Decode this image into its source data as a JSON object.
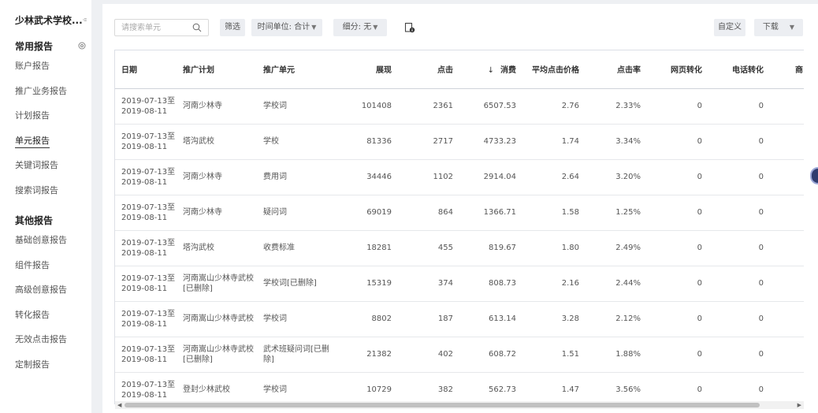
{
  "sidebar": {
    "account_name": "少林武术学校...",
    "groups": [
      {
        "title": "常用报告",
        "items": [
          {
            "label": "账户报告"
          },
          {
            "label": "推广业务报告"
          },
          {
            "label": "计划报告"
          },
          {
            "label": "单元报告",
            "active": true
          },
          {
            "label": "关键词报告"
          },
          {
            "label": "搜索词报告"
          }
        ]
      },
      {
        "title": "其他报告",
        "items": [
          {
            "label": "基础创意报告"
          },
          {
            "label": "组件报告"
          },
          {
            "label": "高级创意报告"
          },
          {
            "label": "转化报告"
          },
          {
            "label": "无效点击报告"
          },
          {
            "label": "定制报告"
          }
        ]
      }
    ]
  },
  "toolbar": {
    "search_placeholder": "请搜索单元",
    "filter_label": "筛选",
    "time_unit_label": "时间单位: 合计",
    "breakdown_label": "细分: 无",
    "customize_label": "自定义",
    "download_label": "下载"
  },
  "table": {
    "headers": [
      "日期",
      "推广计划",
      "推广单元",
      "展现",
      "点击",
      "消费",
      "平均点击价格",
      "点击率",
      "网页转化",
      "电话转化",
      "商"
    ],
    "sorted_column": "消费",
    "rows": [
      [
        "2019-07-13至 2019-08-11",
        "河南少林寺",
        "学校词",
        "101408",
        "2361",
        "6507.53",
        "2.76",
        "2.33%",
        "0",
        "0"
      ],
      [
        "2019-07-13至 2019-08-11",
        "塔沟武校",
        "学校",
        "81336",
        "2717",
        "4733.23",
        "1.74",
        "3.34%",
        "0",
        "0"
      ],
      [
        "2019-07-13至 2019-08-11",
        "河南少林寺",
        "费用词",
        "34446",
        "1102",
        "2914.04",
        "2.64",
        "3.20%",
        "0",
        "0"
      ],
      [
        "2019-07-13至 2019-08-11",
        "河南少林寺",
        "疑问词",
        "69019",
        "864",
        "1366.71",
        "1.58",
        "1.25%",
        "0",
        "0"
      ],
      [
        "2019-07-13至 2019-08-11",
        "塔沟武校",
        "收费标准",
        "18281",
        "455",
        "819.67",
        "1.80",
        "2.49%",
        "0",
        "0"
      ],
      [
        "2019-07-13至 2019-08-11",
        "河南嵩山少林寺武校 [已删除]",
        "学校词[已删除]",
        "15319",
        "374",
        "808.73",
        "2.16",
        "2.44%",
        "0",
        "0"
      ],
      [
        "2019-07-13至 2019-08-11",
        "河南嵩山少林寺武校",
        "学校词",
        "8802",
        "187",
        "613.14",
        "3.28",
        "2.12%",
        "0",
        "0"
      ],
      [
        "2019-07-13至 2019-08-11",
        "河南嵩山少林寺武校 [已删除]",
        "武术班疑问词[已删 除]",
        "21382",
        "402",
        "608.72",
        "1.51",
        "1.88%",
        "0",
        "0"
      ],
      [
        "2019-07-13至 2019-08-11",
        "登封少林武校",
        "学校词",
        "10729",
        "382",
        "562.73",
        "1.47",
        "3.56%",
        "0",
        "0"
      ]
    ]
  },
  "colors": {
    "sidebar_bg": "#ffffff",
    "page_bg": "#eef0f3",
    "button_bg": "#eceef2",
    "border": "#dcdfe6"
  }
}
